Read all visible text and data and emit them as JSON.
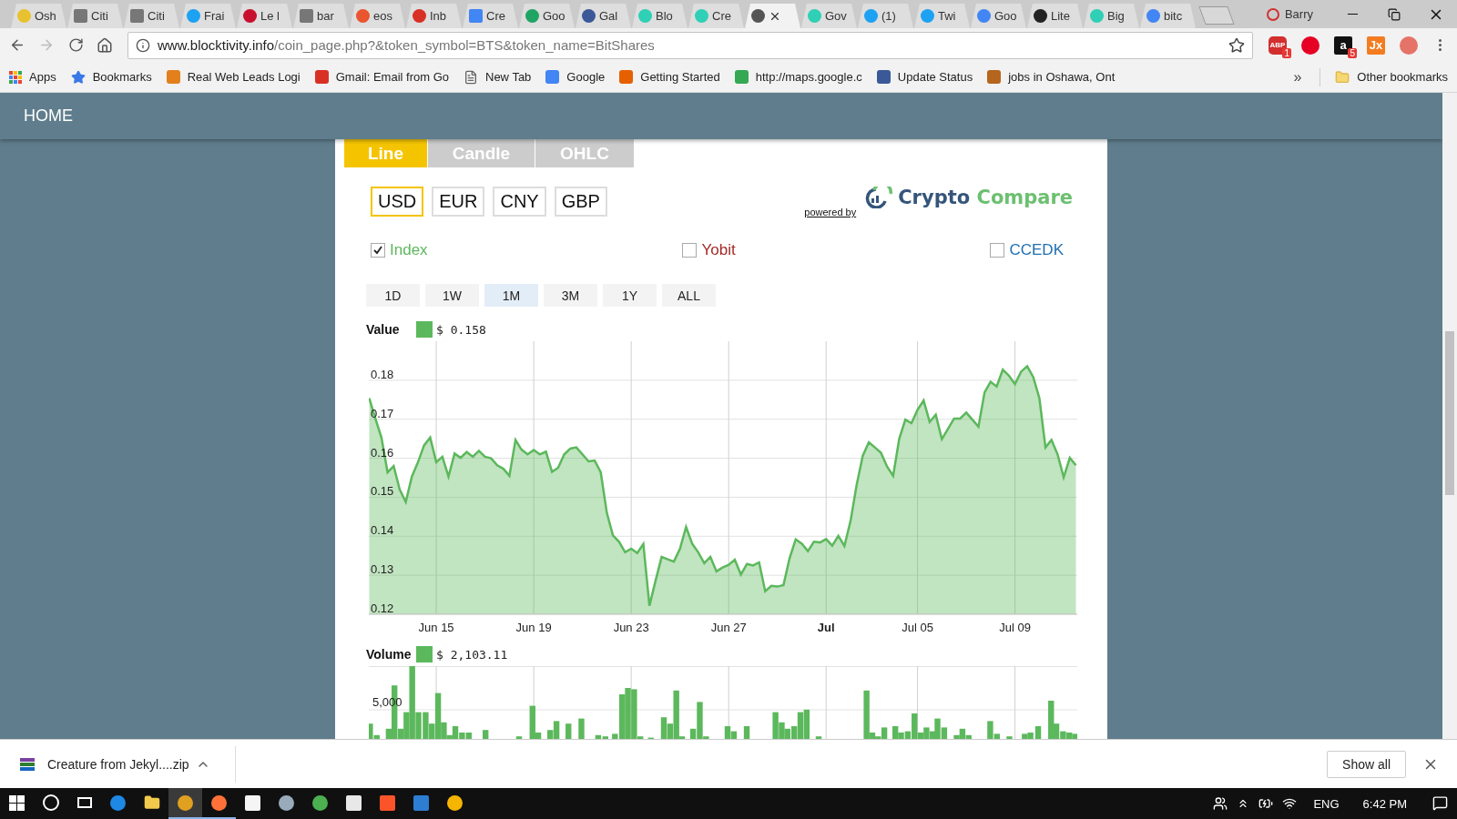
{
  "browser": {
    "tabs": [
      {
        "label": "Osh",
        "kind": "dot",
        "color": "#e8c22e",
        "selected": false
      },
      {
        "label": "Citi",
        "kind": "page",
        "color": "#777777",
        "selected": false
      },
      {
        "label": "Citi",
        "kind": "page",
        "color": "#777777",
        "selected": false
      },
      {
        "label": "Frai",
        "kind": "dot",
        "color": "#1da1f2",
        "selected": false
      },
      {
        "label": "Le l",
        "kind": "dot",
        "color": "#c8102e",
        "selected": false
      },
      {
        "label": "bar",
        "kind": "page",
        "color": "#777777",
        "selected": false
      },
      {
        "label": "eos",
        "kind": "dot",
        "color": "#e8552e",
        "selected": false
      },
      {
        "label": "Inb",
        "kind": "dot",
        "color": "#d93025",
        "selected": false
      },
      {
        "label": "Cre",
        "kind": "page",
        "color": "#4285f4",
        "selected": false
      },
      {
        "label": "Goo",
        "kind": "dot",
        "color": "#1fa463",
        "selected": false
      },
      {
        "label": "Gal",
        "kind": "dot",
        "color": "#3b5998",
        "selected": false
      },
      {
        "label": "Blo",
        "kind": "dot",
        "color": "#2fd0b5",
        "selected": false
      },
      {
        "label": "Cre",
        "kind": "dot",
        "color": "#2fd0b5",
        "selected": false
      },
      {
        "kind": "dot",
        "color": "#555555",
        "selected": true
      },
      {
        "label": "Gov",
        "kind": "dot",
        "color": "#2fd0b5",
        "selected": false
      },
      {
        "label": "(1)",
        "kind": "dot",
        "color": "#1da1f2",
        "selected": false
      },
      {
        "label": "Twi",
        "kind": "dot",
        "color": "#1da1f2",
        "selected": false
      },
      {
        "label": "Goo",
        "kind": "dot",
        "color": "#4285f4",
        "selected": false
      },
      {
        "label": "Lite",
        "kind": "dot",
        "color": "#222222",
        "selected": false
      },
      {
        "label": "Big",
        "kind": "dot",
        "color": "#2fd0b5",
        "selected": false
      },
      {
        "label": "bitc",
        "kind": "dot",
        "color": "#4285f4",
        "selected": false
      }
    ],
    "profile": "Barry",
    "address": {
      "host": "www.blocktivity.info",
      "path": "/coin_page.php?&token_symbol=BTS&token_name=BitShares"
    },
    "extensions": [
      {
        "kind": "octagon",
        "label": "ABP",
        "badge": "1"
      },
      {
        "kind": "circle"
      },
      {
        "kind": "square",
        "label": "a",
        "badge": "5"
      },
      {
        "kind": "orange",
        "label": "Jx"
      },
      {
        "kind": "ring"
      }
    ],
    "bookmarks": [
      {
        "label": "Apps",
        "kind": "apps",
        "color": "#4285f4"
      },
      {
        "label": "Bookmarks",
        "kind": "star",
        "color": "#3b78e7"
      },
      {
        "label": "Real Web Leads Logi",
        "kind": "logo",
        "color": "#e2801d"
      },
      {
        "label": "Gmail: Email from Go",
        "kind": "logo",
        "color": "#d93025"
      },
      {
        "label": "New Tab",
        "kind": "page",
        "color": "#666666"
      },
      {
        "label": "Google",
        "kind": "logo",
        "color": "#4285f4"
      },
      {
        "label": "Getting Started",
        "kind": "logo",
        "color": "#e66000"
      },
      {
        "label": "http://maps.google.c",
        "kind": "logo",
        "color": "#34a853"
      },
      {
        "label": "Update Status",
        "kind": "logo",
        "color": "#3b5998"
      },
      {
        "label": "jobs in Oshawa, Ont",
        "kind": "logo",
        "color": "#b5651d"
      }
    ],
    "overflow": "»",
    "other_bookmarks": "Other bookmarks"
  },
  "page": {
    "nav": "HOME",
    "chart_types": [
      {
        "label": "Line",
        "selected": true
      },
      {
        "label": "Candle",
        "selected": false
      },
      {
        "label": "OHLC",
        "selected": false
      }
    ],
    "currencies": [
      {
        "label": "USD",
        "selected": true
      },
      {
        "label": "EUR",
        "selected": false
      },
      {
        "label": "CNY",
        "selected": false
      },
      {
        "label": "GBP",
        "selected": false
      }
    ],
    "logo": {
      "primary": "Crypto",
      "secondary": "Compare",
      "powered_by": "powered by"
    },
    "markets": [
      {
        "label": "Index",
        "checked": true,
        "color": "#5cb85c"
      },
      {
        "label": "Yobit",
        "checked": false,
        "color": "#a52a2a"
      },
      {
        "label": "CCEDK",
        "checked": false,
        "color": "#1f6fb0"
      }
    ],
    "ranges": [
      {
        "label": "1D",
        "selected": false
      },
      {
        "label": "1W",
        "selected": false
      },
      {
        "label": "1M",
        "selected": true
      },
      {
        "label": "3M",
        "selected": false
      },
      {
        "label": "1Y",
        "selected": false
      },
      {
        "label": "ALL",
        "selected": false
      }
    ],
    "value_reading": "$ 0.158",
    "chart_data": {
      "type": "area",
      "categories": [
        null,
        null,
        null,
        null,
        null,
        null,
        null,
        null,
        null,
        null,
        null,
        "Jun 15",
        null,
        null,
        null,
        null,
        null,
        null,
        null,
        null,
        null,
        null,
        null,
        null,
        null,
        null,
        null,
        "Jun 19",
        null,
        null,
        null,
        null,
        null,
        null,
        null,
        null,
        null,
        null,
        null,
        null,
        null,
        null,
        null,
        "Jun 23",
        null,
        null,
        null,
        null,
        null,
        null,
        null,
        null,
        null,
        null,
        null,
        null,
        null,
        null,
        null,
        "Jun 27",
        null,
        null,
        null,
        null,
        null,
        null,
        null,
        null,
        null,
        null,
        null,
        null,
        null,
        null,
        null,
        "Jul",
        null,
        null,
        null,
        null,
        null,
        null,
        null,
        null,
        null,
        null,
        null,
        null,
        null,
        null,
        "Jul 05",
        null,
        null,
        null,
        null,
        null,
        null,
        null,
        null,
        null,
        null,
        null,
        null,
        null,
        null,
        null,
        "Jul 09",
        null,
        null,
        null,
        null,
        null,
        null,
        null,
        null,
        null,
        null
      ],
      "series": [
        {
          "name": "Value",
          "color": "#5cb85c",
          "values": [
            0.1754,
            0.1702,
            0.1653,
            0.1564,
            0.158,
            0.152,
            0.1488,
            0.1553,
            0.159,
            0.1633,
            0.1653,
            0.159,
            0.1604,
            0.1553,
            0.1612,
            0.1601,
            0.1616,
            0.1604,
            0.1619,
            0.1604,
            0.16,
            0.1582,
            0.1573,
            0.1555,
            0.1647,
            0.1622,
            0.161,
            0.1621,
            0.161,
            0.1617,
            0.1565,
            0.1576,
            0.161,
            0.1625,
            0.1628,
            0.161,
            0.1592,
            0.1594,
            0.1564,
            0.146,
            0.1402,
            0.1386,
            0.1359,
            0.1368,
            0.1357,
            0.138,
            0.1222,
            0.1286,
            0.1347,
            0.1341,
            0.1335,
            0.1368,
            0.1424,
            0.1381,
            0.1359,
            0.1331,
            0.1347,
            0.131,
            0.132,
            0.1327,
            0.134,
            0.1302,
            0.1329,
            0.1325,
            0.1333,
            0.1259,
            0.1273,
            0.1271,
            0.1275,
            0.1344,
            0.1392,
            0.1381,
            0.1362,
            0.1386,
            0.1384,
            0.1393,
            0.1376,
            0.1401,
            0.1375,
            0.1439,
            0.1531,
            0.1606,
            0.1641,
            0.1628,
            0.1614,
            0.1579,
            0.1555,
            0.165,
            0.1699,
            0.169,
            0.1724,
            0.1748,
            0.1693,
            0.1712,
            0.1649,
            0.1675,
            0.1702,
            0.1702,
            0.1717,
            0.1699,
            0.1681,
            0.1769,
            0.1796,
            0.1784,
            0.1827,
            0.1812,
            0.179,
            0.1822,
            0.1836,
            0.1808,
            0.1754,
            0.1628,
            0.1647,
            0.161,
            0.1551,
            0.1601,
            0.1582
          ]
        }
      ],
      "grid": true,
      "ylim": [
        0.12,
        0.19
      ],
      "yticks": [
        {
          "value": 0.12,
          "label": "0.12"
        },
        {
          "value": 0.13,
          "label": "0.13"
        },
        {
          "value": 0.14,
          "label": "0.14"
        },
        {
          "value": 0.15,
          "label": "0.15"
        },
        {
          "value": 0.16,
          "label": "0.16"
        },
        {
          "value": 0.17,
          "label": "0.17"
        },
        {
          "value": 0.18,
          "label": "0.18"
        }
      ]
    },
    "xtick_bold": [
      false,
      false,
      false,
      false,
      true,
      false,
      false
    ],
    "volume": {
      "label": "Volume",
      "color": "#5cb85c",
      "reading": "$ 2,103.11",
      "tick_label": "5,000"
    }
  },
  "downloads": {
    "file": "Creature from Jekyl....zip",
    "show_all": "Show all"
  },
  "taskbar": {
    "apps": [
      {
        "kind": "circle",
        "color": "#1e88e5",
        "selected": false,
        "running": false
      },
      {
        "kind": "folder",
        "color": "#f2c94c",
        "selected": false,
        "running": false
      },
      {
        "kind": "circle",
        "color": "#e0a020",
        "selected": true,
        "running": true
      },
      {
        "kind": "circle",
        "color": "#ff7139",
        "selected": false,
        "running": true
      },
      {
        "kind": "square",
        "color": "#f5f5f5",
        "selected": false,
        "running": false
      },
      {
        "kind": "circle",
        "color": "#99aabb",
        "selected": false,
        "running": false
      },
      {
        "kind": "circle",
        "color": "#4caf50",
        "selected": false,
        "running": false
      },
      {
        "kind": "square",
        "color": "#e8e8e8",
        "selected": false,
        "running": false
      },
      {
        "kind": "square",
        "color": "#fb542b",
        "selected": false,
        "running": false
      },
      {
        "kind": "square",
        "color": "#2d7dd2",
        "selected": false,
        "running": false
      },
      {
        "kind": "circle",
        "color": "#f6b500",
        "selected": false,
        "running": false
      }
    ],
    "language": "ENG",
    "time": "6:42 PM"
  }
}
